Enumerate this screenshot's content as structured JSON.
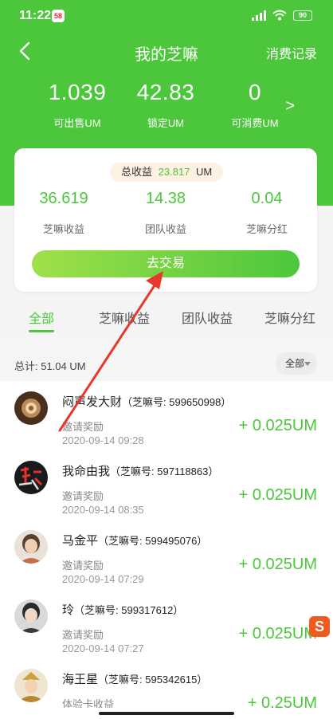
{
  "status": {
    "time": "11:22",
    "app_badge": "58",
    "battery": "90"
  },
  "nav": {
    "title": "我的芝嘛",
    "right_label": "消费记录"
  },
  "stats": [
    {
      "value": "1.039",
      "label": "可出售UM"
    },
    {
      "value": "42.83",
      "label": "锁定UM"
    },
    {
      "value": "0",
      "label": "可消费UM"
    }
  ],
  "stats_more": ">",
  "card": {
    "total_label": "总收益",
    "total_value": "23.817",
    "total_unit": "UM",
    "items": [
      {
        "value": "36.619",
        "label": "芝嘛收益"
      },
      {
        "value": "14.38",
        "label": "团队收益"
      },
      {
        "value": "0.04",
        "label": "芝嘛分红"
      }
    ],
    "button_label": "去交易"
  },
  "tabs": [
    {
      "label": "全部",
      "active": true
    },
    {
      "label": "芝嘛收益",
      "active": false
    },
    {
      "label": "团队收益",
      "active": false
    },
    {
      "label": "芝嘛分红",
      "active": false
    }
  ],
  "summary": {
    "text": "总计: 51.04 UM",
    "filter_label": "全部"
  },
  "records": [
    {
      "name": "闷声发大财",
      "id": "（芝嘛号: 599650998）",
      "type": "邀请奖励",
      "time": "2020-09-14 09:28",
      "amount": "+ 0.025UM"
    },
    {
      "name": "我命由我",
      "id": "（芝嘛号: 597118863）",
      "type": "邀请奖励",
      "time": "2020-09-14 08:35",
      "amount": "+ 0.025UM"
    },
    {
      "name": "马金平",
      "id": "（芝嘛号: 599495076）",
      "type": "邀请奖励",
      "time": "2020-09-14 07:29",
      "amount": "+ 0.025UM"
    },
    {
      "name": "玲",
      "id": "（芝嘛号: 599317612）",
      "type": "邀请奖励",
      "time": "2020-09-14 07:27",
      "amount": "+ 0.025UM"
    },
    {
      "name": "海王星",
      "id": "（芝嘛号: 595342615）",
      "type": "体验卡收益",
      "time": "",
      "amount": "+ 0.25UM"
    }
  ],
  "overlay": {
    "ime_badge": "S"
  },
  "colors": {
    "brand_green": "#4cc73c",
    "annotation_red": "#e8382b",
    "pill_bg": "#fdf1e4"
  }
}
